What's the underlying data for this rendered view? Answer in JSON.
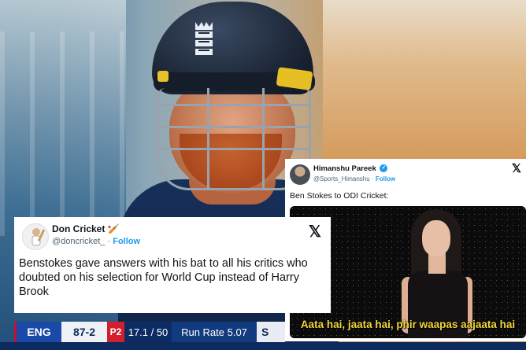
{
  "tweet_don": {
    "name": "Don Cricket",
    "badge_emoji": "🏏",
    "handle": "@doncricket_",
    "follow": "Follow",
    "separator": "·",
    "x_logo": "𝕏",
    "text": "Benstokes gave answers with his bat to all his critics who doubted on his selection for World Cup instead of Harry Brook"
  },
  "tweet_himanshu": {
    "name": "Himanshu Pareek",
    "verified": "✓",
    "handle": "@Sports_Himanshu",
    "follow": "Follow",
    "separator": "·",
    "x_logo": "𝕏",
    "text": "Ben Stokes to ODI Cricket:",
    "media_caption": "Aata hai, jaata hai, phir waapas aajaata hai"
  },
  "scoreboard": {
    "team": "ENG",
    "score": "87-2",
    "powerplay": "P2",
    "overs": "17.1 / 50",
    "run_rate": "Run Rate 5.07",
    "more": "S"
  },
  "colors": {
    "twitter_blue": "#1d9bf0",
    "caption_yellow": "#f2d73b",
    "eng_blue": "#1a4aa8",
    "powerplay_red": "#d21f2e"
  },
  "icons": [
    "x-logo-icon",
    "verified-badge-icon",
    "bat-emoji-icon"
  ]
}
